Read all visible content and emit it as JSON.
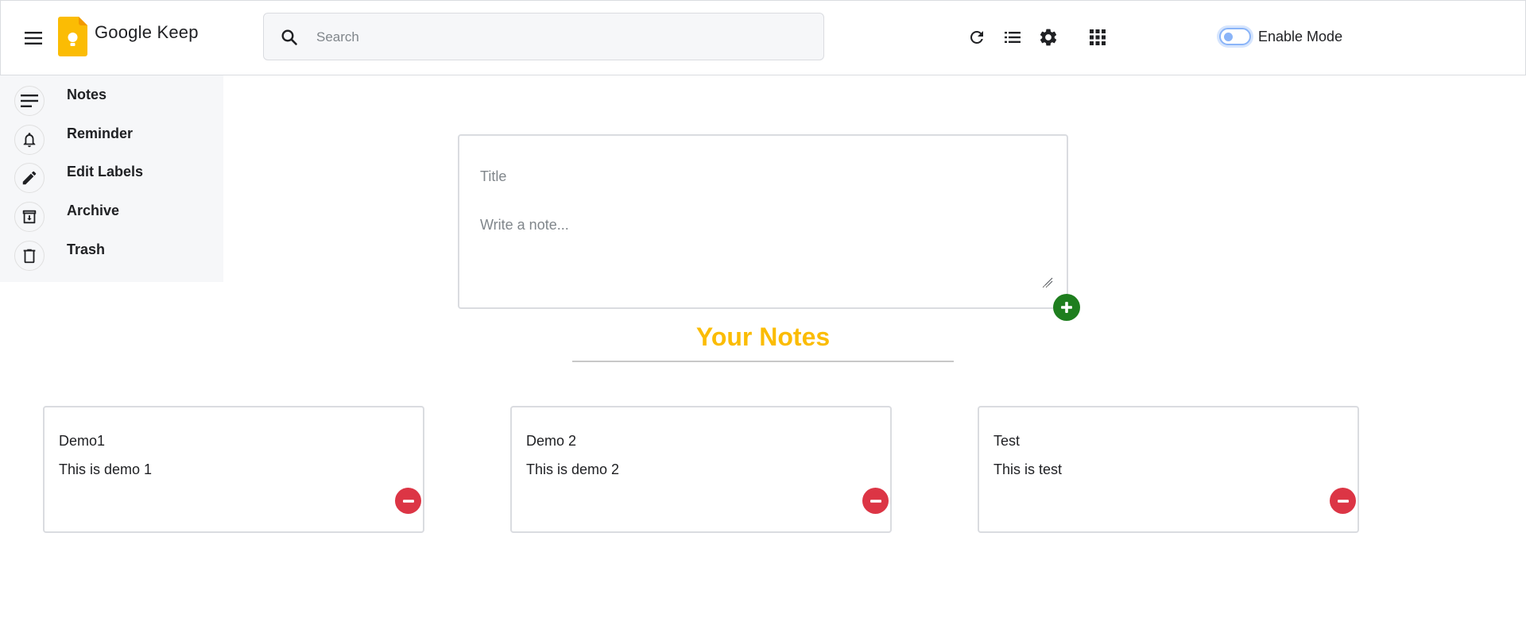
{
  "header": {
    "app_title": "Google Keep",
    "search_placeholder": "Search",
    "search_value": "",
    "toggle_label": "Enable Mode",
    "toggle_on": false,
    "icons": [
      "menu-icon",
      "keep-logo",
      "search-icon",
      "refresh-icon",
      "list-view-icon",
      "settings-icon",
      "apps-grid-icon"
    ]
  },
  "sidebar": {
    "items": [
      {
        "label": "Notes",
        "icon": "notes-icon"
      },
      {
        "label": "Reminder",
        "icon": "bell-icon"
      },
      {
        "label": "Edit Labels",
        "icon": "pencil-icon"
      },
      {
        "label": "Archive",
        "icon": "archive-icon"
      },
      {
        "label": "Trash",
        "icon": "trash-icon"
      }
    ]
  },
  "composer": {
    "title_placeholder": "Title",
    "note_placeholder": "Write a note...",
    "title_value": "",
    "note_value": "",
    "add_icon": "plus-icon"
  },
  "notes_section": {
    "heading": "Your Notes",
    "heading_color": "#fbbc04"
  },
  "notes": [
    {
      "title": "Demo1",
      "body": "This is demo 1"
    },
    {
      "title": "Demo 2",
      "body": "This is demo 2"
    },
    {
      "title": "Test",
      "body": "This is test"
    }
  ],
  "colors": {
    "accent": "#fbbc04",
    "add_button": "#1e7e1e",
    "delete_button": "#dc3545",
    "toggle": "#8ab4f8"
  }
}
